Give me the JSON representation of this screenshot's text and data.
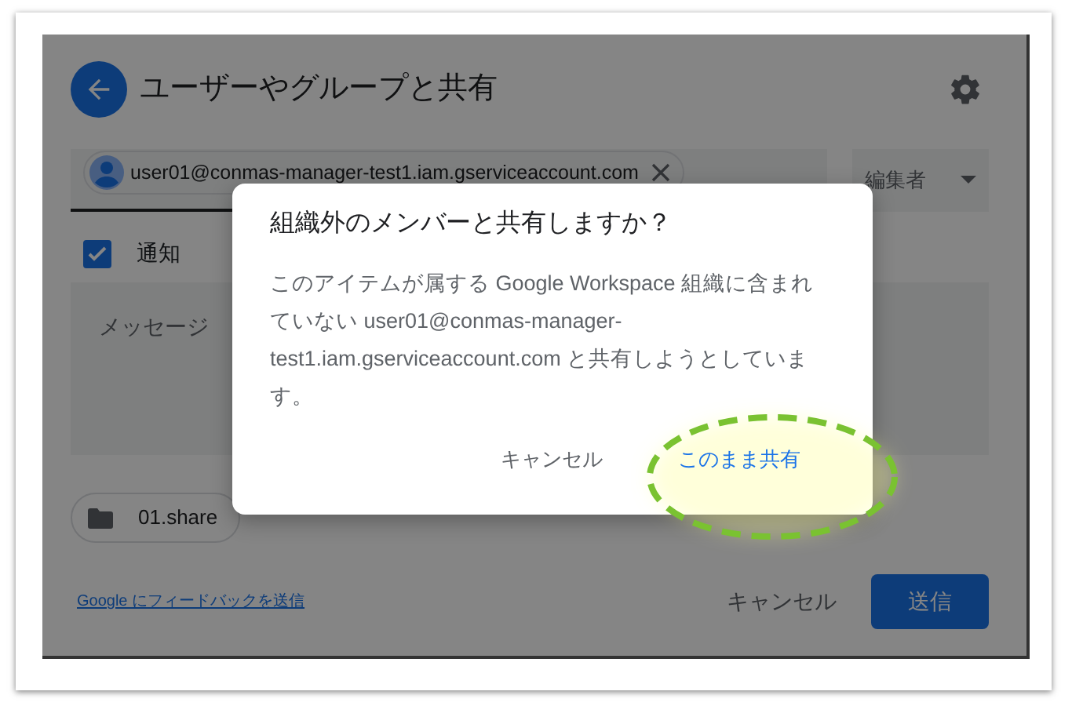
{
  "header": {
    "title": "ユーザーやグループと共有"
  },
  "recipient": {
    "email": "user01@conmas-manager-test1.iam.gserviceaccount.com"
  },
  "role_dropdown": {
    "label": "編集者"
  },
  "notify": {
    "label": "通知",
    "checked": true
  },
  "message": {
    "placeholder": "メッセージ"
  },
  "item_chip": {
    "label": "01.share"
  },
  "footer": {
    "feedback_link": "Google にフィードバックを送信",
    "cancel": "キャンセル",
    "send": "送信"
  },
  "dialog": {
    "title": "組織外のメンバーと共有しますか？",
    "body": "このアイテムが属する Google Workspace 組織に含まれていない user01@conmas-manager-test1.iam.gserviceaccount.com と共有しようとしています。",
    "buttons": [
      {
        "label": "キャンセル",
        "primary": false
      },
      {
        "label": "このまま共有",
        "primary": true
      }
    ]
  }
}
